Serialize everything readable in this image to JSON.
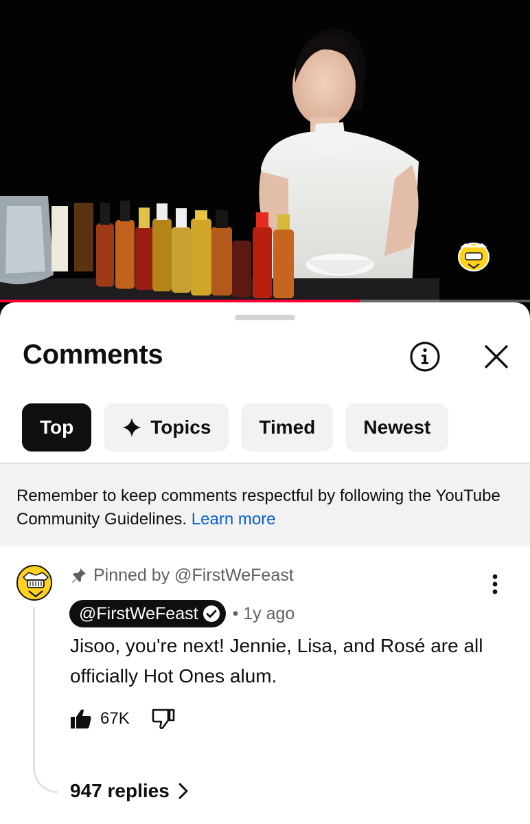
{
  "video": {
    "progress": 0.68,
    "channel_logo": "first-we-feast-logo"
  },
  "sheet": {
    "title": "Comments",
    "info_icon": "info-icon",
    "close_icon": "close-icon"
  },
  "filters": [
    {
      "label": "Top",
      "active": true
    },
    {
      "label": "Topics",
      "icon": "sparkle-icon"
    },
    {
      "label": "Timed"
    },
    {
      "label": "Newest"
    }
  ],
  "notice": {
    "text": "Remember to keep comments respectful by following the YouTube Community Guidelines.",
    "link": "Learn more"
  },
  "comment": {
    "pinned_text": "Pinned by @FirstWeFeast",
    "author": "@FirstWeFeast",
    "time": "1y ago",
    "text": "Jisoo, you're next! Jennie, Lisa, and Rosé are all officially Hot Ones alum.",
    "likes": "67K",
    "replies": "947 replies"
  },
  "colors": {
    "progress": "#ff0033",
    "link": "#065fd4",
    "chip_active": "#0f0f0f",
    "chip": "#f2f2f2"
  }
}
